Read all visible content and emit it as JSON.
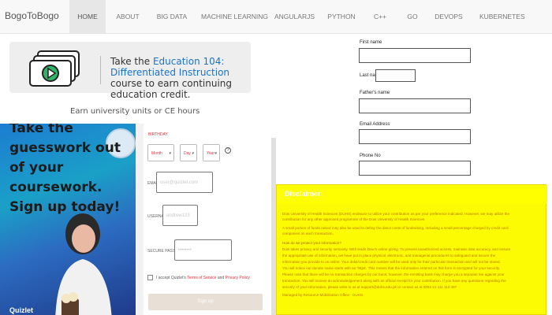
{
  "nav": {
    "brand": "BogoToBogo",
    "items": [
      "HOME",
      "ABOUT",
      "BIG DATA",
      "MACHINE LEARNING",
      "ANGULARJS",
      "PYTHON",
      "C++",
      "GO",
      "DEVOPS",
      "KUBERNETES"
    ],
    "active": "HOME"
  },
  "ad": {
    "line1_prefix": "Take the ",
    "line1_highlight": "Education 104:",
    "line2_highlight": "Differentiated Instruction",
    "line3": "course to earn continuing",
    "line4": "education credit.",
    "caption": "Earn university units or CE hours"
  },
  "promo": {
    "text_line1": "Take the guesswork out",
    "text_line2": "of your coursework.",
    "text_line3": "Sign up today!",
    "logo": "Quizlet"
  },
  "signup": {
    "birthday_label": "BIRTHDAY",
    "month": "Month",
    "day": "Day",
    "year": "Year",
    "help": "?",
    "email_label": "EMAIL",
    "email_placeholder": "user@quizlet.com",
    "username_label": "USERNAME",
    "username_placeholder": "andrew123",
    "password_label": "SECURE PASSWORD",
    "password_placeholder": "••••••••",
    "agree_prefix": "I accept Quizlet's ",
    "agree_terms": "Terms of Service",
    "agree_and": " and ",
    "agree_privacy": "Privacy Policy",
    "button": "Sign up"
  },
  "form": {
    "first_name": "First name",
    "last_name": "Last name",
    "fathers_name": "Father's name",
    "email_address": "Email Address",
    "phone_no": "Phone No"
  },
  "disclaimer": {
    "title": "Disclaimer",
    "lines": [
      "Dow University of Health Sciences (DUHS) endeavor to utilize your contribution as per your preference indicated. However, we may utilize the",
      "contribution for any other approved programme of the Dow University of Health Sciences.",
      "A small portion of funds raised may also be used to defray the direct costs of fundraising, including a small percentage charged by credit card",
      "companies on each transaction.",
      "How do we protect your information?",
      "Dow takes privacy and security seriously. With leads Dow's online giving. To prevent unauthorized access, maintain data accuracy, and ensure",
      "the appropriate use of information, we have put in place physical, electronic, and managerial procedures to safeguard and secure the",
      "information you provide to us online. Your debit/credit card number will be used only for their particular transaction and will not be stored.",
      "You will notice our donate name starts with an 'https'. This means that the information entered on this form is encrypted for your security.",
      "Please note that there will be no transaction charges by our bank; however, the remitting bank may charge you a separate fee against your",
      "transaction. You will receive an acknowledgement along with an official receipt for your contribution. If you have any questions regarding the",
      "security of your information, please write to us at support@duhs.edu.pk or contact us at 0092 21 111 113 497",
      "Managed by Resource Mobilization Office - DUHS."
    ]
  }
}
